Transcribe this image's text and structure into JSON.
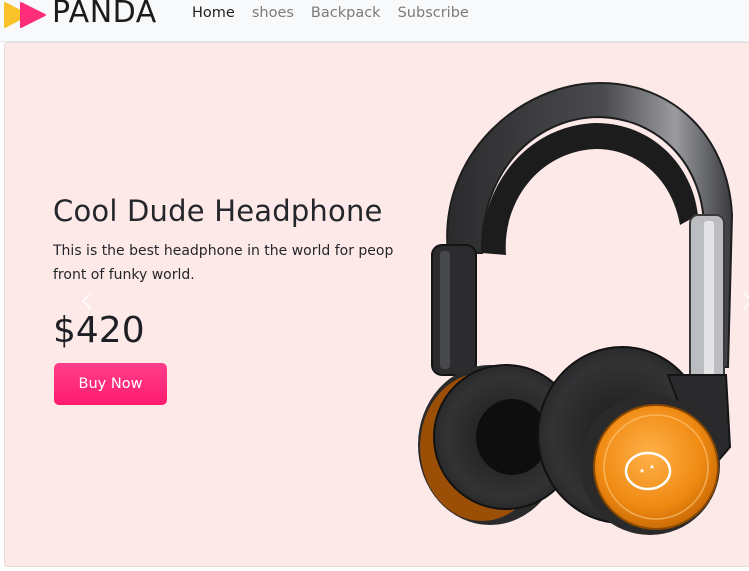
{
  "brand": {
    "name": "PANDA",
    "logo_icon": "play-arrows-icon"
  },
  "nav": {
    "items": [
      "Home",
      "shoes",
      "Backpack",
      "Subscribe"
    ],
    "active": "Home"
  },
  "hero": {
    "title": "Cool Dude Headphone",
    "description": "This is the best headphone in the world for people in front of funky world.",
    "price": "$420",
    "button_label": "Buy Now",
    "background": "#fce9e8",
    "button_color": "#ff2d7a",
    "product_image": "orange-black-headphone"
  },
  "colors": {
    "nav_bg": "#f8f9fa",
    "logo_yellow": "#f9c22a",
    "logo_pink": "#ff2d7a"
  }
}
